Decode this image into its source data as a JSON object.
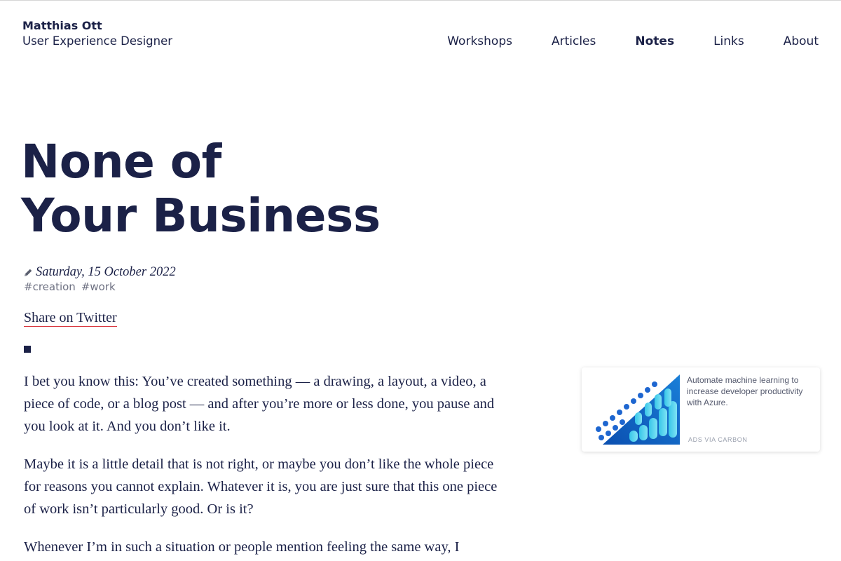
{
  "header": {
    "name": "Matthias Ott",
    "role": "User Experience Designer",
    "nav": [
      {
        "label": "Workshops",
        "active": false
      },
      {
        "label": "Articles",
        "active": false
      },
      {
        "label": "Notes",
        "active": true
      },
      {
        "label": "Links",
        "active": false
      },
      {
        "label": "About",
        "active": false
      }
    ]
  },
  "post": {
    "title_line1": "None of",
    "title_line2": "Your Business",
    "date": "Saturday, 15 October 2022",
    "tags": [
      "#creation",
      "#work"
    ],
    "share_label": "Share on Twitter",
    "paragraphs": [
      "I bet you know this: You’ve created something — a drawing, a layout, a video, a piece of code, or a blog post — and after you’re more or less done, you pause and you look at it. And you don’t like it.",
      "Maybe it is a little detail that is not right, or maybe you don’t like the whole piece for reasons you cannot explain. Whatever it is, you are just sure that this one piece of work isn’t particularly good. Or is it?",
      "Whenever I’m in such a situation or people mention feeling the same way, I"
    ]
  },
  "ad": {
    "text": "Automate machine learning to increase developer productivity with Azure.",
    "via": "ADS VIA CARBON"
  },
  "colors": {
    "text": "#1b2147",
    "link_underline": "#d8343d",
    "tag": "#6e7182"
  },
  "icons": {
    "date": "pencil-icon"
  }
}
